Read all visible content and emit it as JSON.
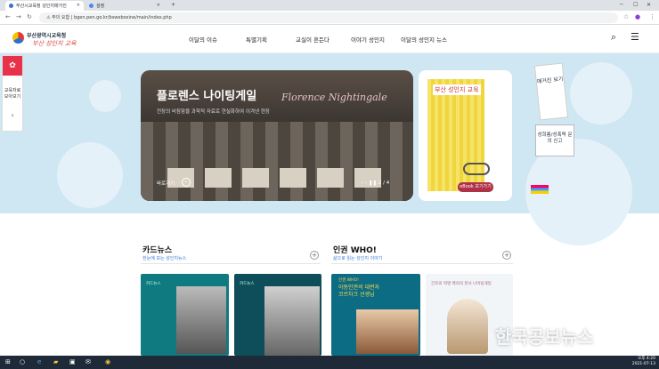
{
  "browser": {
    "tabs": [
      {
        "title": "부산시교육청 성인지매거진",
        "active": true
      },
      {
        "title": "설정",
        "active": false
      }
    ],
    "new_tab": "+",
    "address_security": "주의 요함",
    "address_url": "bgen.pen.go.kr/bsweboxine/main/index.php"
  },
  "site": {
    "logo_org": "부산광역시교육청",
    "logo_title": "부산 성인지 교육",
    "nav": [
      "이달의 이슈",
      "특별기획",
      "교실이 흔든다",
      "이야기 성인지",
      "이달의 성인지 뉴스"
    ]
  },
  "side_tab": {
    "label_line1": "교육자료",
    "label_line2": "모아보기",
    "arrow": "›"
  },
  "hero": {
    "title": "플로렌스 나이팅게일",
    "script": "Florence Nightingale",
    "subtitle": "전장의 비참함을 과학적 자료로 현실화하여 이겨낸 현장 ",
    "more_label": "바로가기",
    "page": "2 / 4",
    "prev": "‹",
    "next": "›",
    "pause": "❚❚"
  },
  "book": {
    "cover_title": "부산 성인지 교육",
    "button": "eBook 보기가기"
  },
  "side_links": {
    "magazine": "매거진 보기",
    "report": "성희롱/성폭력 문의 신고"
  },
  "sections": {
    "card_news": {
      "title": "카드뉴스",
      "sub": "한눈에 보는 성인지뉴스"
    },
    "who": {
      "title": "인권 WHO!",
      "sub": "삶으로 읽는 성인지 이야기"
    }
  },
  "cards": [
    {
      "label": "카드뉴스"
    },
    {
      "label": "카드뉴스"
    },
    {
      "label": "인권 WHO!",
      "text1": "아동인권의 대변자",
      "text2": "코르차크 선생님"
    },
    {
      "label": "간호의 혁명 백의의 천사 나이팅게일"
    }
  ],
  "watermark": "한국공보뉴스",
  "clock": {
    "time": "오후 4:20",
    "date": "2021-07-13"
  },
  "colors": {
    "accent": "#e8324a",
    "hero_bg": "#cfe6f3",
    "card_teal": "#0f7a80"
  }
}
